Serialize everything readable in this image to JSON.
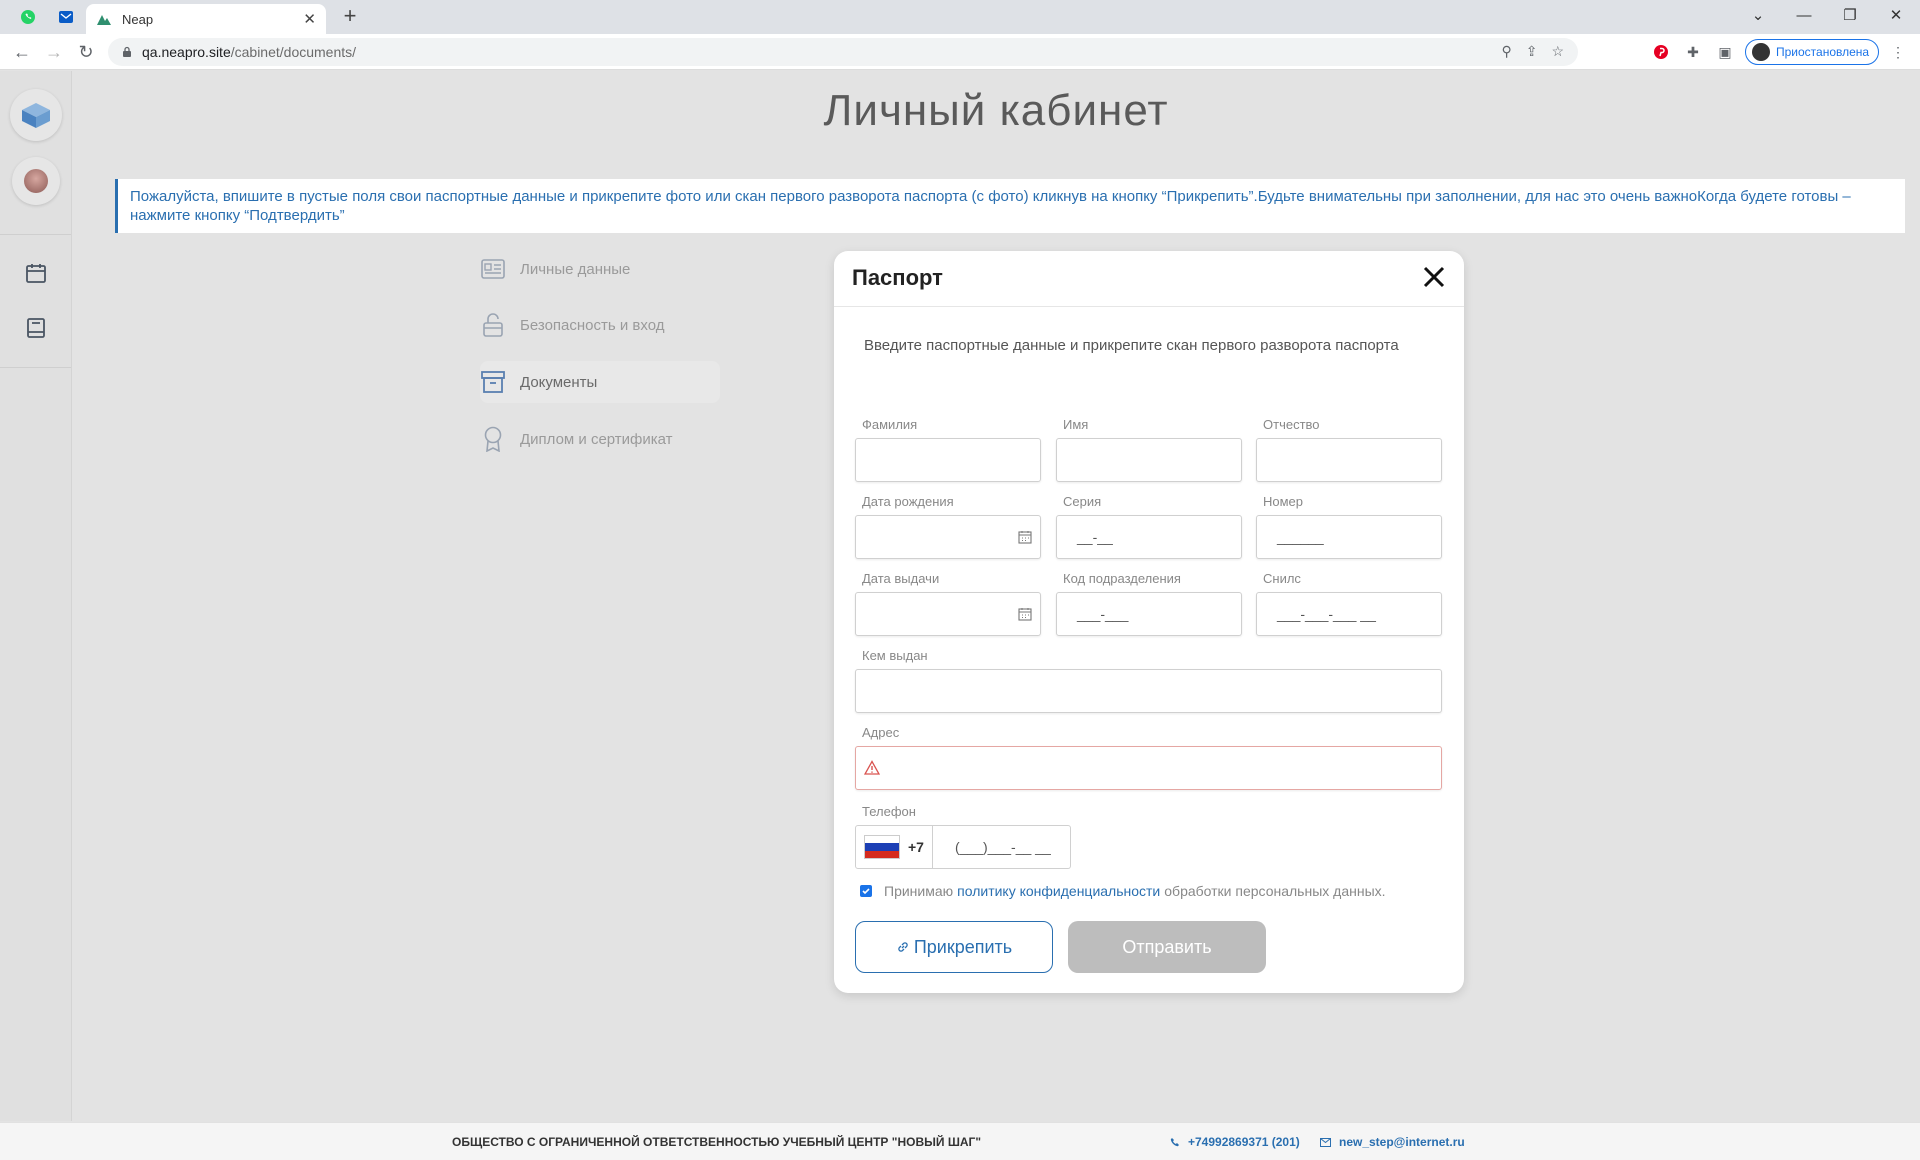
{
  "browser": {
    "tab_title": "Neap",
    "url_host": "qa.neapro.site",
    "url_path": "/cabinet/documents/",
    "profile_status": "Приостановлена",
    "accent_color": "#1a73e8"
  },
  "page": {
    "title": "Личный кабинет",
    "notice": "Пожалуйста, впишите в пустые поля свои паспортные данные и прикрепите фото или скан первого разворота паспорта (с фото) кликнув на кнопку “Прикрепить”.Будьте внимательны при заполнении, для нас это очень важноКогда будете готовы – нажмите кнопку “Подтвердить”",
    "accent_color": "#2a6fb0"
  },
  "menu": {
    "items": [
      {
        "label": "Личные данные",
        "icon": "id-card-icon"
      },
      {
        "label": "Безопасность и вход",
        "icon": "lock-icon"
      },
      {
        "label": "Документы",
        "icon": "archive-box-icon",
        "active": true
      },
      {
        "label": "Диплом и сертификат",
        "icon": "award-icon"
      }
    ]
  },
  "modal": {
    "title": "Паспорт",
    "subtitle": "Введите паспортные данные и прикрепите скан первого разворота паспорта",
    "fields": {
      "last_name": {
        "label": "Фамилия",
        "value": ""
      },
      "first_name": {
        "label": "Имя",
        "value": ""
      },
      "patronymic": {
        "label": "Отчество",
        "value": ""
      },
      "birth_date": {
        "label": "Дата рождения",
        "value": ""
      },
      "series": {
        "label": "Серия",
        "value": "__-__"
      },
      "number": {
        "label": "Номер",
        "value": "______"
      },
      "issue_date": {
        "label": "Дата выдачи",
        "value": ""
      },
      "division_code": {
        "label": "Код подразделения",
        "value": "___-___"
      },
      "snils": {
        "label": "Снилс",
        "value": "___-___-___ __"
      },
      "issued_by": {
        "label": "Кем выдан",
        "value": ""
      },
      "address": {
        "label": "Адрес",
        "value": "",
        "error": true
      },
      "phone": {
        "label": "Телефон",
        "country_code": "+7",
        "value": "(___)___-__ __"
      }
    },
    "consent": {
      "checked": true,
      "before": "Принимаю",
      "link": "политику конфиденциальности",
      "after": "обработки персональных данных."
    },
    "attach_label": "Прикрепить",
    "send_label": "Отправить"
  },
  "footer": {
    "org": "ОБЩЕСТВО С ОГРАНИЧЕННОЙ ОТВЕТСТВЕННОСТЬЮ УЧЕБНЫЙ ЦЕНТР \"НОВЫЙ ШАГ\"",
    "phone": "+74992869371 (201)",
    "email": "new_step@internet.ru"
  }
}
